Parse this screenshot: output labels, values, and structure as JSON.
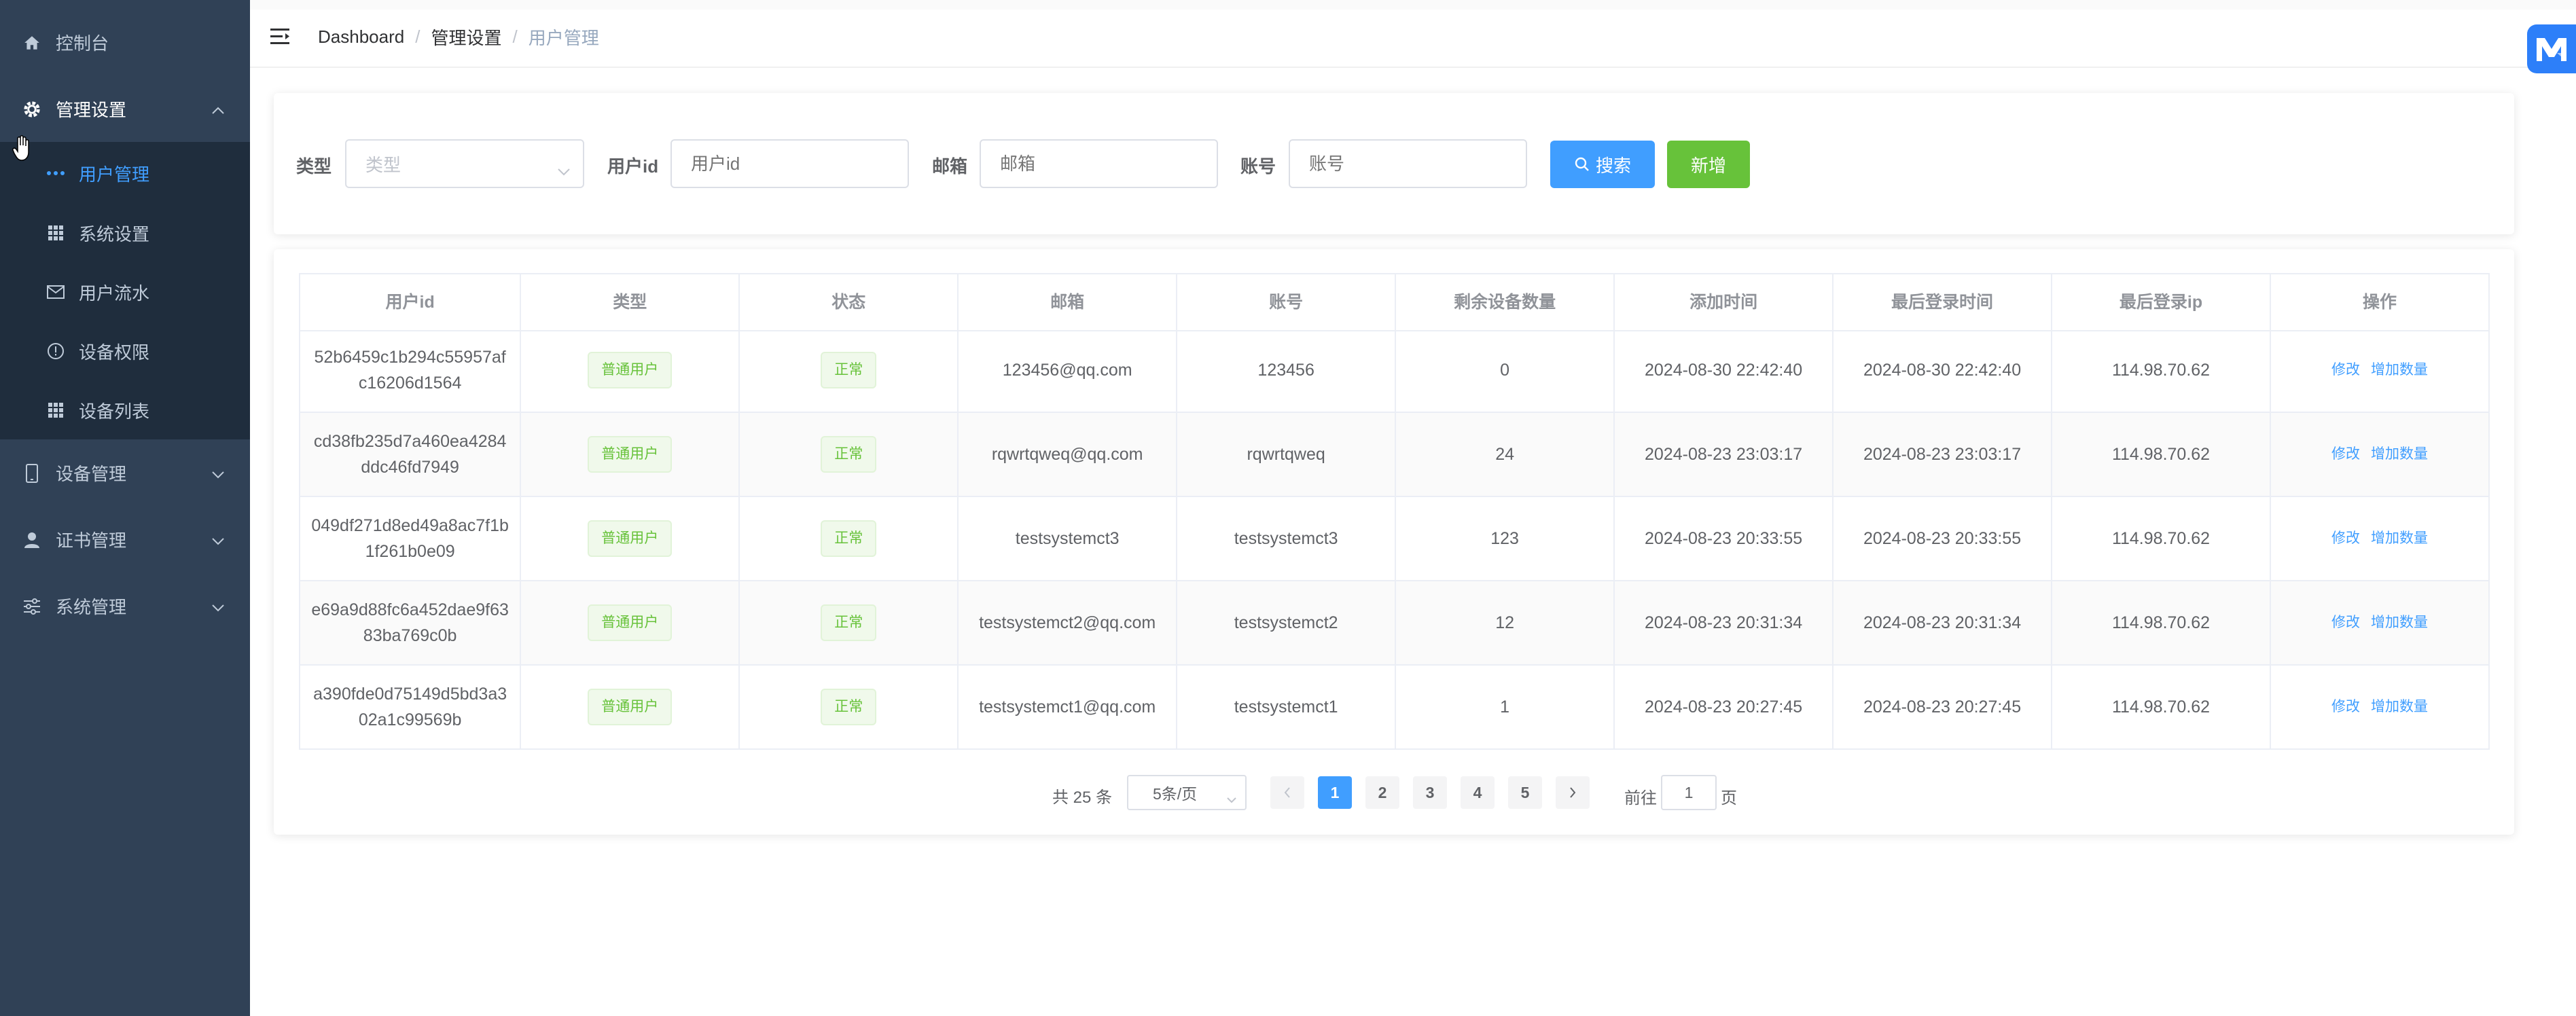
{
  "sidebar": {
    "dashboard": "控制台",
    "admin_settings": "管理设置",
    "sub_items": [
      "用户管理",
      "系统设置",
      "用户流水",
      "设备权限",
      "设备列表"
    ],
    "device_mgmt": "设备管理",
    "cert_mgmt": "证书管理",
    "system_mgmt": "系统管理",
    "colors": {
      "bg": "#304156",
      "sub_bg": "#1f2d3d",
      "active": "#409eff"
    }
  },
  "breadcrumb": [
    "Dashboard",
    "管理设置",
    "用户管理"
  ],
  "breadcrumb_sep": "/",
  "search": {
    "type_label": "类型",
    "type_placeholder": "类型",
    "userid_label": "用户id",
    "userid_placeholder": "用户id",
    "email_label": "邮箱",
    "email_placeholder": "邮箱",
    "account_label": "账号",
    "account_placeholder": "账号",
    "search_button": "搜索",
    "add_button": "新增"
  },
  "table": {
    "headers": [
      "用户id",
      "类型",
      "状态",
      "邮箱",
      "账号",
      "剩余设备数量",
      "添加时间",
      "最后登录时间",
      "最后登录ip",
      "操作"
    ],
    "rows": [
      {
        "id": "52b6459c1b294c55957afc16206d1564",
        "type": "普通用户",
        "status": "正常",
        "email": "123456@qq.com",
        "account": "123456",
        "remaining": "0",
        "added": "2024-08-30 22:42:40",
        "last_login": "2024-08-30 22:42:40",
        "ip": "114.98.70.62"
      },
      {
        "id": "cd38fb235d7a460ea4284ddc46fd7949",
        "type": "普通用户",
        "status": "正常",
        "email": "rqwrtqweq@qq.com",
        "account": "rqwrtqweq",
        "remaining": "24",
        "added": "2024-08-23 23:03:17",
        "last_login": "2024-08-23 23:03:17",
        "ip": "114.98.70.62"
      },
      {
        "id": "049df271d8ed49a8ac7f1b1f261b0e09",
        "type": "普通用户",
        "status": "正常",
        "email": "testsystemct3",
        "account": "testsystemct3",
        "remaining": "123",
        "added": "2024-08-23 20:33:55",
        "last_login": "2024-08-23 20:33:55",
        "ip": "114.98.70.62"
      },
      {
        "id": "e69a9d88fc6a452dae9f6383ba769c0b",
        "type": "普通用户",
        "status": "正常",
        "email": "testsystemct2@qq.com",
        "account": "testsystemct2",
        "remaining": "12",
        "added": "2024-08-23 20:31:34",
        "last_login": "2024-08-23 20:31:34",
        "ip": "114.98.70.62"
      },
      {
        "id": "a390fde0d75149d5bd3a302a1c99569b",
        "type": "普通用户",
        "status": "正常",
        "email": "testsystemct1@qq.com",
        "account": "testsystemct1",
        "remaining": "1",
        "added": "2024-08-23 20:27:45",
        "last_login": "2024-08-23 20:27:45",
        "ip": "114.98.70.62"
      }
    ],
    "op_edit": "修改",
    "op_add": "增加数量"
  },
  "pagination": {
    "total_text": "共 25 条",
    "page_size": "5条/页",
    "pages": [
      "1",
      "2",
      "3",
      "4",
      "5"
    ],
    "current": "1",
    "goto_label": "前往",
    "goto_value": "1",
    "goto_suffix": "页"
  }
}
